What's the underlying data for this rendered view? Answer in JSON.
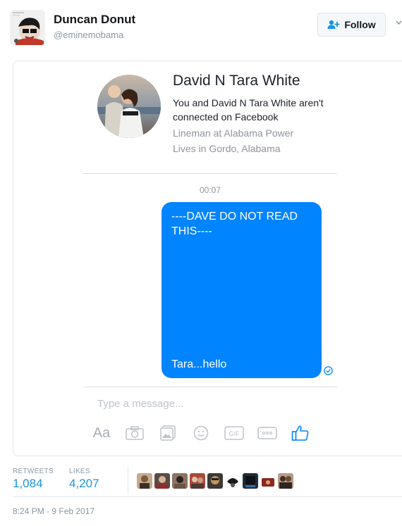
{
  "author": {
    "display_name": "Duncan Donut",
    "handle": "@eminemobama",
    "avatar": "author-avatar"
  },
  "follow_button": {
    "label": "Follow",
    "icon": "add-user-icon"
  },
  "screenshot": {
    "contact": {
      "name": "David N Tara White",
      "connection_note": "You and David N Tara White aren't connected on Facebook",
      "work": "Lineman at Alabama Power",
      "location": "Lives in Gordo, Alabama"
    },
    "timestamp": "00:07",
    "message": {
      "top_text": "----DAVE DO NOT READ THIS----",
      "bottom_text": "Tara...hello",
      "bubble_color": "#0084ff"
    },
    "composer_placeholder": "Type a message...",
    "toolbar": {
      "aa_label": "Aa",
      "gif_label": "GIF",
      "icons": [
        "text-format-icon",
        "camera-icon",
        "gallery-icon",
        "emoji-icon",
        "gif-icon",
        "more-icon",
        "thumbs-up-icon"
      ]
    }
  },
  "stats": {
    "retweets_label": "RETWEETS",
    "retweets_count": "1,084",
    "likes_label": "LIKES",
    "likes_count": "4,207"
  },
  "liker_avatars": [
    "liker-1",
    "liker-2",
    "liker-3",
    "liker-4",
    "liker-5",
    "liker-6",
    "liker-7",
    "liker-8",
    "liker-9"
  ],
  "timestamp": "8:24 PM - 9 Feb 2017",
  "colors": {
    "accent": "#1b95e0",
    "messenger_blue": "#0084ff",
    "muted_text": "#8899a6"
  }
}
